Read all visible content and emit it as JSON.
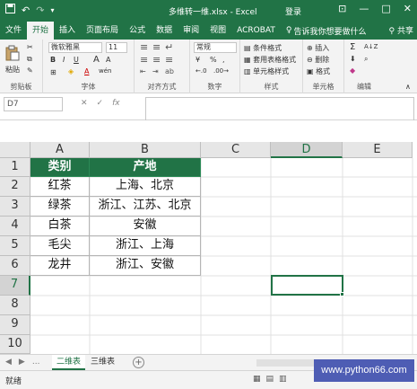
{
  "titlebar": {
    "title": "多维转一维.xlsx - Excel",
    "login": "登录",
    "save_icon": "save-icon",
    "undo_icon": "undo-icon",
    "redo_icon": "redo-icon",
    "minimize": "—",
    "restore": "□",
    "close": "✕",
    "ribbon_options": "⊡"
  },
  "tabs": {
    "items": [
      "文件",
      "开始",
      "插入",
      "页面布局",
      "公式",
      "数据",
      "审阅",
      "视图",
      "ACROBAT"
    ],
    "active": "开始",
    "tell_me": "告诉我你想要做什么",
    "share": "共享"
  },
  "ribbon": {
    "clipboard": {
      "label": "剪贴板",
      "paste": "粘贴"
    },
    "font": {
      "label": "字体",
      "font_name": "微软雅黑",
      "font_size": "11",
      "bold": "B",
      "italic": "I",
      "underline": "U",
      "grow": "A",
      "shrink": "A",
      "wen": "wén"
    },
    "alignment": {
      "label": "对齐方式"
    },
    "number": {
      "label": "数字",
      "format": "常规",
      "percent": "%",
      "comma": ",",
      "currency": "¥"
    },
    "styles": {
      "label": "样式",
      "conditional": "条件格式",
      "table": "套用表格格式",
      "cell": "单元格样式"
    },
    "cells": {
      "label": "单元格",
      "insert": "插入",
      "delete": "删除",
      "format": "格式"
    },
    "editing": {
      "label": "编辑",
      "sum": "Σ",
      "sort": "A↓Z",
      "find": "⌕"
    }
  },
  "formula_bar": {
    "name_box": "D7",
    "cancel": "✕",
    "enter": "✓",
    "fx": "fx",
    "value": ""
  },
  "columns": [
    "A",
    "B",
    "C",
    "D",
    "E"
  ],
  "rows": [
    "1",
    "2",
    "3",
    "4",
    "5",
    "6",
    "7",
    "8",
    "9",
    "10"
  ],
  "table": {
    "headers": [
      "类别",
      "产地"
    ],
    "rows": [
      [
        "红茶",
        "上海、北京"
      ],
      [
        "绿茶",
        "浙江、江苏、北京"
      ],
      [
        "白茶",
        "安徽"
      ],
      [
        "毛尖",
        "浙江、上海"
      ],
      [
        "龙井",
        "浙江、安徽"
      ]
    ]
  },
  "selected_cell": "D7",
  "sheets": {
    "items": [
      "二维表",
      "三维表"
    ],
    "active": "二维表",
    "nav": [
      "◀",
      "▶",
      "..."
    ],
    "add": "+"
  },
  "status": {
    "ready": "就绪"
  },
  "watermark": "www.python66.com",
  "colors": {
    "excel_green": "#217346",
    "header_fill": "#217346",
    "watermark_bg": "#4e5db4"
  }
}
